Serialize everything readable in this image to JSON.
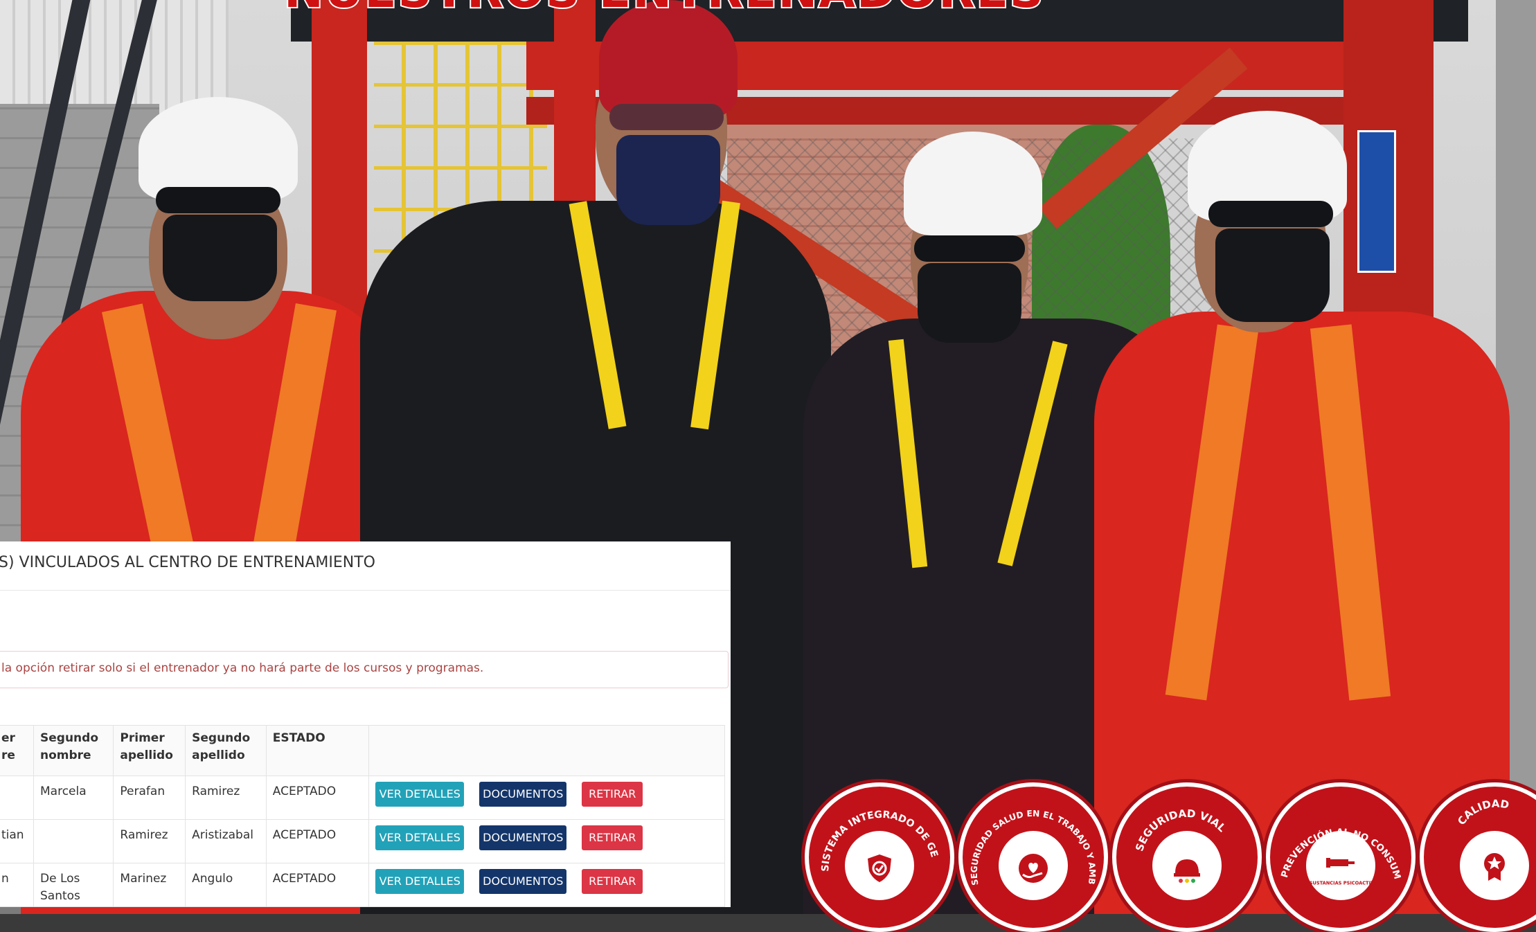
{
  "page": {
    "heading": "NUESTROS ENTRENADORES"
  },
  "panel": {
    "title": "S) VINCULADOS AL CENTRO DE ENTRENAMIENTO",
    "alert": "la opción retirar solo si el entrenador ya no hará parte de los cursos y programas.",
    "columns": [
      "er re",
      "Segundo nombre",
      "Primer apellido",
      "Segundo apellido",
      "ESTADO",
      ""
    ],
    "column_lines": [
      [
        "er",
        "re"
      ],
      [
        "Segundo",
        "nombre"
      ],
      [
        "Primer",
        "apellido"
      ],
      [
        "Segundo",
        "apellido"
      ],
      [
        "ESTADO"
      ],
      [
        ""
      ]
    ],
    "rows": [
      {
        "c1": "",
        "segundo_nombre": "Marcela",
        "primer_apellido": "Perafan",
        "segundo_apellido": "Ramirez",
        "estado": "ACEPTADO"
      },
      {
        "c1": "tian",
        "segundo_nombre": "",
        "primer_apellido": "Ramirez",
        "segundo_apellido": "Aristizabal",
        "estado": "ACEPTADO"
      },
      {
        "c1": "n",
        "segundo_nombre": "De Los Santos",
        "primer_apellido": "Marinez",
        "segundo_apellido": "Angulo",
        "estado": "ACEPTADO"
      }
    ],
    "actions": {
      "details": "VER DETALLES",
      "documents": "DOCUMENTOS",
      "withdraw": "RETIRAR"
    }
  },
  "badges": [
    {
      "label": "SISTEMA INTEGRADO DE GESTIÓN",
      "icon": "shield-check-icon"
    },
    {
      "label": "SEGURIDAD SALUD EN EL TRABAJO Y AMBIENTE",
      "icon": "hand-heart-icon"
    },
    {
      "label": "SEGURIDAD VIAL",
      "icon": "hard-hat-traffic-light-icon"
    },
    {
      "label": "PREVENCIÓN AL NO CONSUMO",
      "sublabel": "DE SUSTANCIAS PSICOACTIVAS",
      "icon": "syringe-icon"
    },
    {
      "label": "CALIDAD",
      "icon": "ribbon-star-icon"
    }
  ],
  "colors": {
    "brand_red": "#c1121a",
    "info": "#22a2b8",
    "navy": "#13356a",
    "danger": "#dc3545",
    "alert_text": "#a94442"
  }
}
